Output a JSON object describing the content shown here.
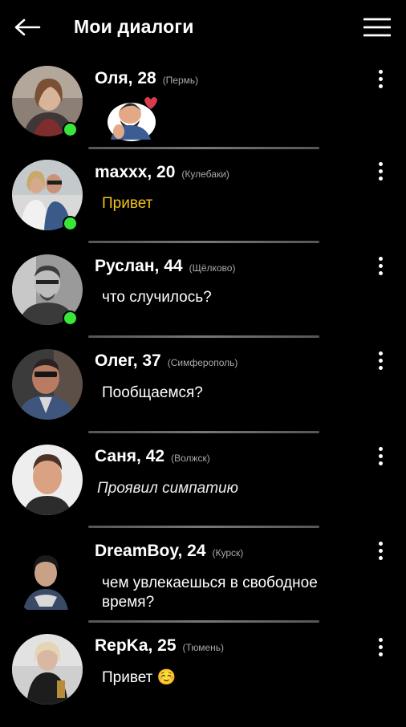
{
  "header": {
    "title": "Мои диалоги"
  },
  "dialogs": [
    {
      "name": "Оля, 28",
      "city": "(Пермь)",
      "message": "",
      "online": true
    },
    {
      "name": "maxxx, 20",
      "city": "(Кулебаки)",
      "message": "Привет",
      "online": true
    },
    {
      "name": "Руслан, 44",
      "city": "(Щёлково)",
      "message": "что случилось?",
      "online": true
    },
    {
      "name": "Олег, 37",
      "city": "(Симферополь)",
      "message": "Пообщаемся?",
      "online": false
    },
    {
      "name": "Саня, 42",
      "city": "(Волжск)",
      "message": "Проявил симпатию",
      "online": false
    },
    {
      "name": "DreamBoy, 24",
      "city": "(Курск)",
      "message": "чем увлекаешься в свободное время?",
      "online": false
    },
    {
      "name": "RepKa, 25",
      "city": "(Тюмень)",
      "message": "Привет ☺️",
      "online": false
    }
  ],
  "colors": {
    "online": "#39e639",
    "highlight": "#f0c419"
  }
}
